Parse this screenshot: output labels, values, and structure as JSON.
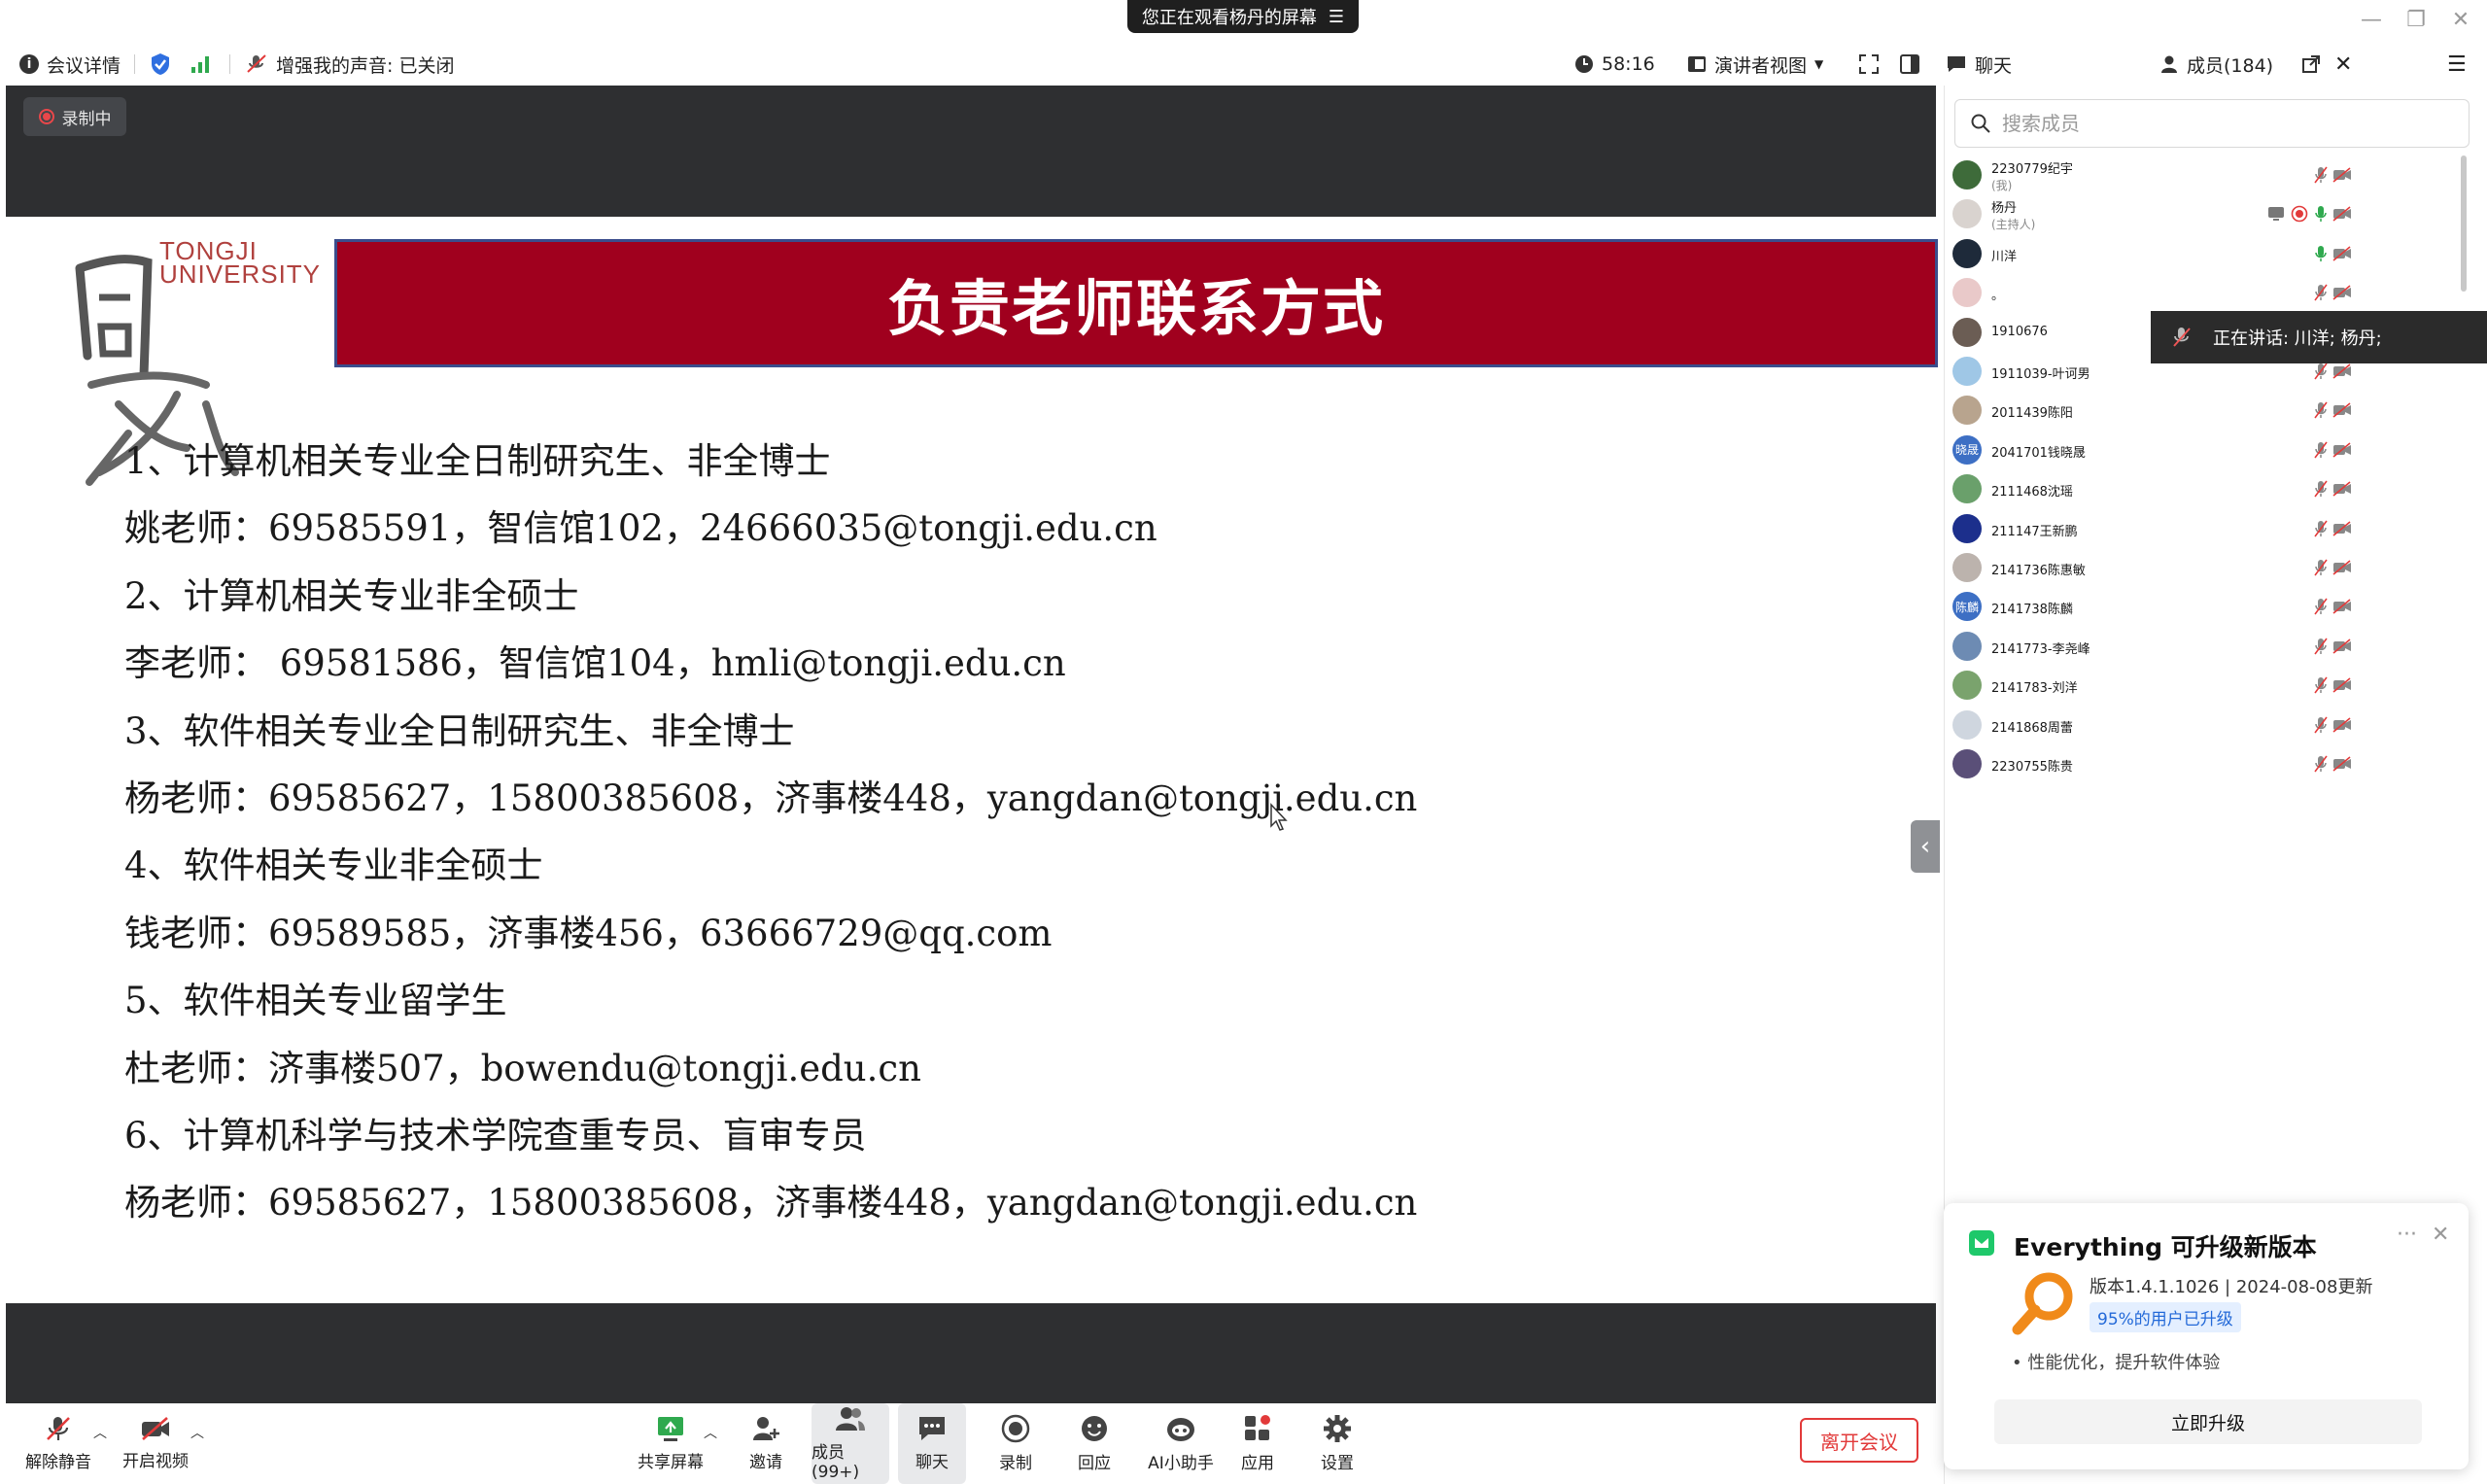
{
  "window": {
    "share_banner": "您正在观看杨丹的屏幕",
    "controls": [
      "minimize-icon",
      "restore-icon",
      "close-icon"
    ]
  },
  "meeting_bar": {
    "info": "会议详情",
    "voice": "增强我的声音: 已关闭",
    "timer": "58:16",
    "view_mode": "演讲者视图",
    "chat_tab": "聊天",
    "members_tab": "成员(184)"
  },
  "recording_badge": "录制中",
  "slide": {
    "logo_en_1": "TONGJI",
    "logo_en_2": "UNIVERSITY",
    "title": "负责老师联系方式",
    "lines": [
      "1、计算机相关专业全日制研究生、非全博士",
      "姚老师：69585591，智信馆102，24666035@tongji.edu.cn",
      "2、计算机相关专业非全硕士",
      "李老师： 69581586，智信馆104，hmli@tongji.edu.cn",
      "3、软件相关专业全日制研究生、非全博士",
      "杨老师：69585627，15800385608，济事楼448，yangdan@tongji.edu.cn",
      "4、软件相关专业非全硕士",
      "钱老师：69589585，济事楼456，63666729@qq.com",
      "5、软件相关专业留学生",
      "杜老师：济事楼507，bowendu@tongji.edu.cn",
      "6、计算机科学与技术学院查重专员、盲审专员",
      "杨老师：69585627，15800385608，济事楼448，yangdan@tongji.edu.cn"
    ]
  },
  "bottom_bar": {
    "unmute": "解除静音",
    "start_video": "开启视频",
    "share": "共享屏幕",
    "invite": "邀请",
    "members": "成员(99+)",
    "chat": "聊天",
    "record": "录制",
    "playback": "回应",
    "ai": "AI小助手",
    "apps": "应用",
    "settings": "设置",
    "leave": "离开会议"
  },
  "members_panel": {
    "search_placeholder": "搜索成员",
    "speaking": "正在讲话:  川洋; 杨丹;",
    "list": [
      {
        "name": "2230779纪宇",
        "role": "(我)",
        "avatar_color": "#3e6b3a",
        "avatar_text": ""
      },
      {
        "name": "杨丹",
        "role": "(主持人)",
        "avatar_color": "#d9d3cf",
        "avatar_text": ""
      },
      {
        "name": "川洋",
        "role": "",
        "avatar_color": "#1e2a3a",
        "avatar_text": ""
      },
      {
        "name": "。",
        "role": "",
        "avatar_color": "#e9c9c9",
        "avatar_text": ""
      },
      {
        "name": "1910676",
        "role": "",
        "avatar_color": "#6b5d54",
        "avatar_text": ""
      },
      {
        "name": "1911039-叶诃男",
        "role": "",
        "avatar_color": "#9fc7e6",
        "avatar_text": ""
      },
      {
        "name": "2011439陈阳",
        "role": "",
        "avatar_color": "#b8a48e",
        "avatar_text": ""
      },
      {
        "name": "2041701钱晓晟",
        "role": "",
        "avatar_color": "#3d6fc4",
        "avatar_text": "晓晟"
      },
      {
        "name": "2111468沈瑶",
        "role": "",
        "avatar_color": "#6aa06b",
        "avatar_text": ""
      },
      {
        "name": "211147王新鹏",
        "role": "",
        "avatar_color": "#1c2f8c",
        "avatar_text": ""
      },
      {
        "name": "2141736陈惠敏",
        "role": "",
        "avatar_color": "#bcb3ad",
        "avatar_text": ""
      },
      {
        "name": "2141738陈麟",
        "role": "",
        "avatar_color": "#3d6fc4",
        "avatar_text": "陈麟"
      },
      {
        "name": "2141773-李尧峰",
        "role": "",
        "avatar_color": "#6d8bb3",
        "avatar_text": ""
      },
      {
        "name": "2141783-刘洋",
        "role": "",
        "avatar_color": "#7aa36d",
        "avatar_text": ""
      },
      {
        "name": "2141868周蕾",
        "role": "",
        "avatar_color": "#cfd6df",
        "avatar_text": ""
      },
      {
        "name": "2230755陈贵",
        "role": "",
        "avatar_color": "#5a4f78",
        "avatar_text": ""
      }
    ]
  },
  "popup": {
    "title": "Everything 可升级新版本",
    "version": "版本1.4.1.1026  |  2024-08-08更新",
    "upgraded": "95%的用户已升级",
    "feature": "• 性能优化，提升软件体验",
    "button": "立即升级"
  },
  "colors": {
    "slide_title_bg": "#a0001e",
    "leave_red": "#e23a3a",
    "dark_bg": "#2e2f31",
    "accent_blue": "#2369d8"
  }
}
